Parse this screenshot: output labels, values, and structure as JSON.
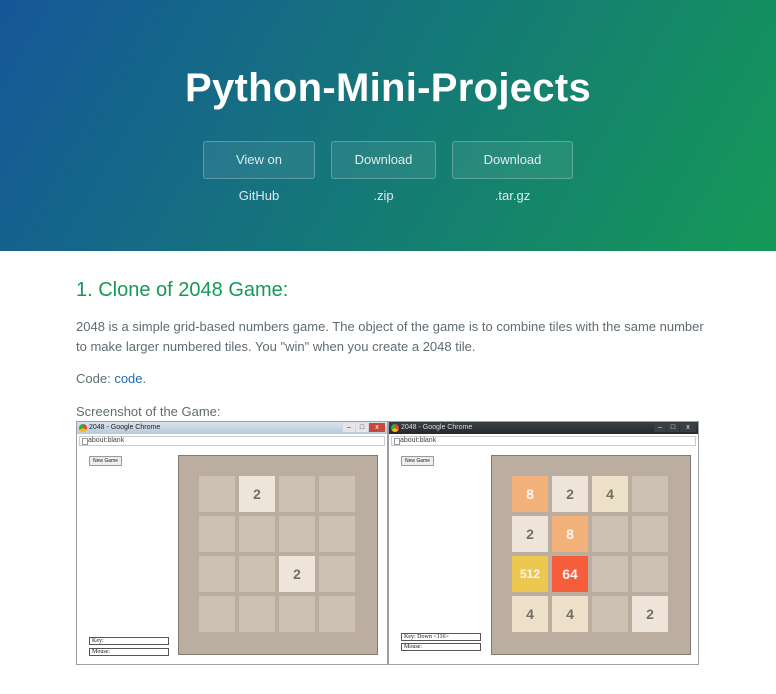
{
  "header": {
    "title": "Python-Mini-Projects",
    "buttons": {
      "github": "View on GitHub",
      "zip": "Download .zip",
      "tar": "Download .tar.gz"
    }
  },
  "main": {
    "heading": "1. Clone of 2048 Game:",
    "description": "2048 is a simple grid-based numbers game. The object of the game is to combine tiles with the same number to make larger numbered tiles. You \"win\" when you create a 2048 tile.",
    "code_prefix": "Code: ",
    "code_link": "code",
    "code_suffix": ".",
    "screenshot_caption": "Screenshot of the Game:"
  },
  "screenshot_left": {
    "window_title": "2048 - Google Chrome",
    "address": "about:blank",
    "new_game": "New Game",
    "key_label": "Key:",
    "mouse_label": "Mouse:",
    "grid": [
      [
        "",
        "2",
        "",
        ""
      ],
      [
        "",
        "",
        "",
        ""
      ],
      [
        "",
        "",
        "2",
        ""
      ],
      [
        "",
        "",
        "",
        ""
      ]
    ]
  },
  "screenshot_right": {
    "window_title": "2048 - Google Chrome",
    "address": "about:blank",
    "new_game": "New Game",
    "key_label": "Key: Down <116>",
    "mouse_label": "Mouse:",
    "grid": [
      [
        "8",
        "2",
        "4",
        ""
      ],
      [
        "2",
        "8",
        "",
        ""
      ],
      [
        "512",
        "64",
        "",
        ""
      ],
      [
        "4",
        "4",
        "",
        "2"
      ]
    ]
  },
  "colors": {
    "header_gradient_start": "#155799",
    "header_gradient_end": "#159957",
    "heading": "#159957",
    "link": "#1e6bb8",
    "board": "#bbada0",
    "empty_tile": "#cdc1b4"
  }
}
